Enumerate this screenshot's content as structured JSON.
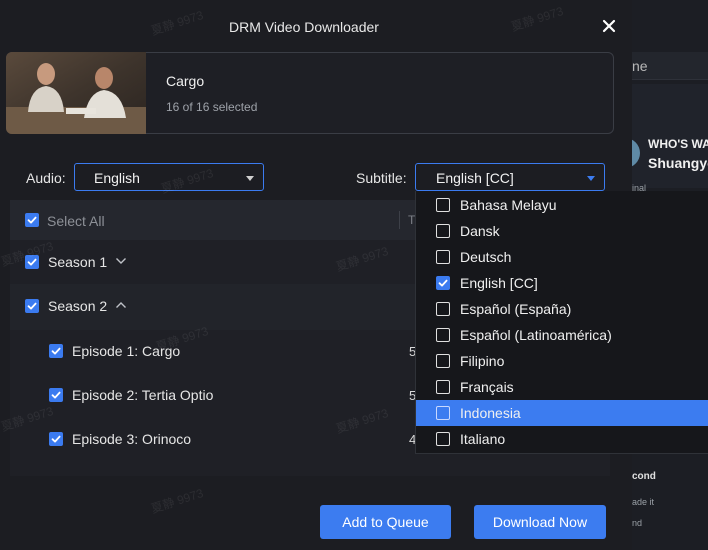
{
  "dialog": {
    "title": "DRM Video Downloader",
    "close_icon": "close-icon"
  },
  "video": {
    "title": "Cargo",
    "selected_text": "16 of 16 selected"
  },
  "audio": {
    "label": "Audio:",
    "value": "English"
  },
  "subtitle": {
    "label": "Subtitle:",
    "value": "English [CC]",
    "options": [
      {
        "label": "Bahasa Melayu",
        "checked": false,
        "highlighted": false
      },
      {
        "label": "Dansk",
        "checked": false,
        "highlighted": false
      },
      {
        "label": "Deutsch",
        "checked": false,
        "highlighted": false
      },
      {
        "label": "English [CC]",
        "checked": true,
        "highlighted": false
      },
      {
        "label": "Español (España)",
        "checked": false,
        "highlighted": false
      },
      {
        "label": "Español (Latinoamérica)",
        "checked": false,
        "highlighted": false
      },
      {
        "label": "Filipino",
        "checked": false,
        "highlighted": false
      },
      {
        "label": "Français",
        "checked": false,
        "highlighted": false
      },
      {
        "label": "Indonesia",
        "checked": false,
        "highlighted": true
      },
      {
        "label": "Italiano",
        "checked": false,
        "highlighted": false
      }
    ]
  },
  "table": {
    "select_all": "Select All",
    "col_t": "T",
    "seasons": [
      {
        "label": "Season 1",
        "expanded": false
      },
      {
        "label": "Season 2",
        "expanded": true
      }
    ],
    "episodes": [
      {
        "label": "Episode 1: Cargo",
        "size": "5"
      },
      {
        "label": "Episode 2: Tertia Optio",
        "size": "5"
      },
      {
        "label": "Episode 3: Orinoco",
        "size": "4"
      }
    ]
  },
  "buttons": {
    "add_to_queue": "Add to Queue",
    "download_now": "Download Now"
  },
  "background": {
    "search_fragment": "ne",
    "whos": "WHO'S WA",
    "name": "Shuangyo",
    "small1": "inal",
    "bold": "cond",
    "small2": "ade it",
    "small3": "nd"
  },
  "watermark": "夏静 9973",
  "colors": {
    "accent": "#3c7cf0",
    "dialog_bg": "#1c1d22",
    "dropdown_bg": "#16171b"
  }
}
